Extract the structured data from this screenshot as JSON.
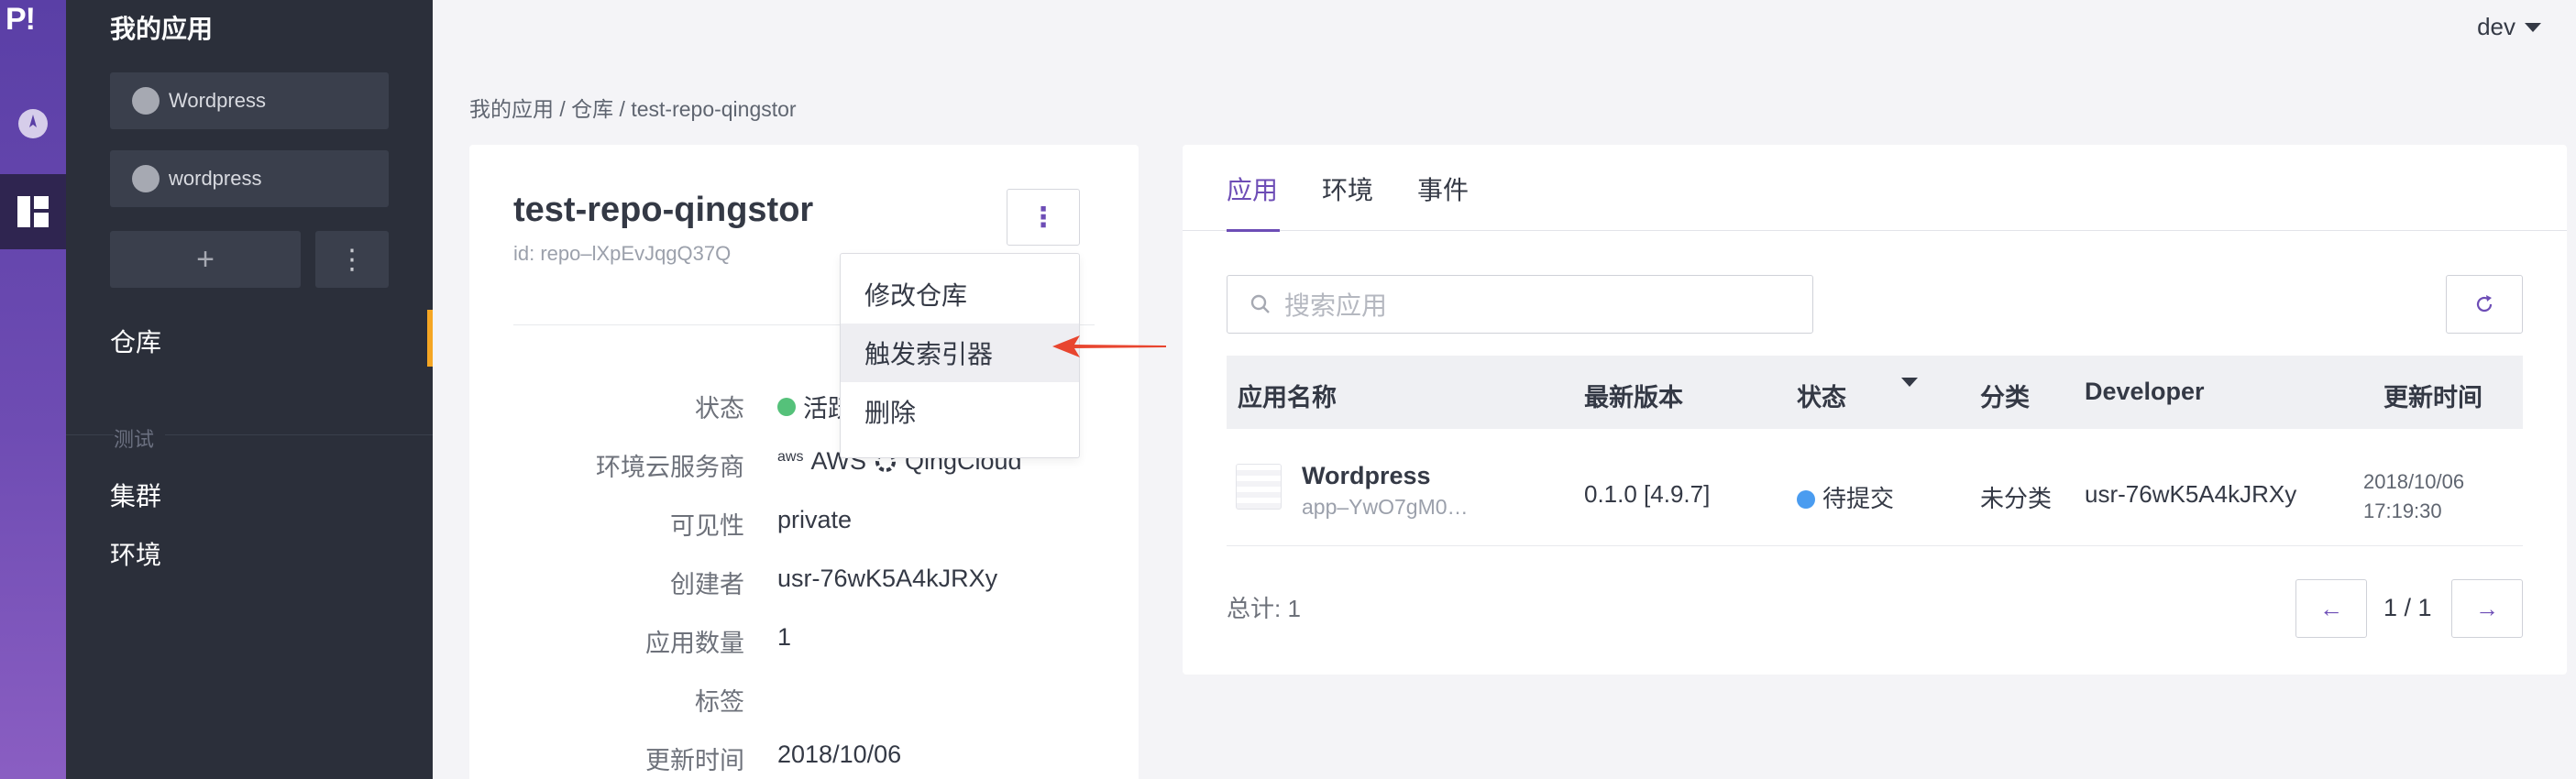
{
  "rail": {
    "logo": "P!",
    "icons": [
      "dashboard-icon",
      "apps-grid-icon"
    ]
  },
  "sidebar": {
    "title": "我的应用",
    "apps": [
      "Wordpress",
      "wordpress"
    ],
    "add_label": "+",
    "more_label": "⋮",
    "active_item": "仓库",
    "section_label": "测试",
    "items": [
      "集群",
      "环境"
    ]
  },
  "user": {
    "name": "dev"
  },
  "breadcrumb": "我的应用 / 仓库 / test-repo-qingstor",
  "repo": {
    "name": "test-repo-qingstor",
    "id": "id: repo–lXpEvJqgQ37Q",
    "more_label": "⋮",
    "fields": [
      {
        "key": "状态",
        "value": "活跃"
      },
      {
        "key": "环境云服务商",
        "value": "AWS  QingCloud"
      },
      {
        "key": "可见性",
        "value": "private"
      },
      {
        "key": "创建者",
        "value": "usr-76wK5A4kJRXy"
      },
      {
        "key": "应用数量",
        "value": "1"
      },
      {
        "key": "标签",
        "value": ""
      },
      {
        "key": "更新时间",
        "value": "2018/10/06"
      }
    ],
    "provider_aws_logo": "aws",
    "provider_aws": "AWS",
    "provider_qc": "QingCloud"
  },
  "menu": {
    "items": [
      "修改仓库",
      "触发索引器",
      "删除"
    ],
    "highlighted": 1
  },
  "annotation_color": "#e8452f",
  "tabs": [
    "应用",
    "环境",
    "事件"
  ],
  "search": {
    "placeholder": "搜索应用"
  },
  "table": {
    "headers": [
      "应用名称",
      "最新版本",
      "状态",
      "分类",
      "Developer",
      "更新时间"
    ],
    "rows": [
      {
        "name": "Wordpress",
        "id": "app–YwO7gM0…",
        "version": "0.1.0 [4.9.7]",
        "status": "待提交",
        "category": "未分类",
        "developer": "usr-76wK5A4kJRXy",
        "date": "2018/10/06",
        "time": "17:19:30"
      }
    ]
  },
  "pagination": {
    "total": "总计: 1",
    "page": "1 / 1",
    "prev": "←",
    "next": "→"
  },
  "colors": {
    "accent": "#6d4db6",
    "status_active": "#55c17a",
    "status_pending": "#4a9cf0"
  }
}
